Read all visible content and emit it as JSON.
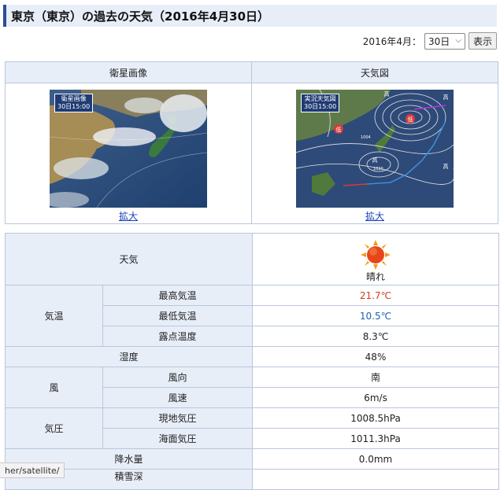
{
  "page": {
    "title": "東京（東京）の過去の天気（2016年4月30日）"
  },
  "date_select": {
    "month_label": "2016年4月：",
    "day_value": "30日",
    "show_button": "表示"
  },
  "maps": {
    "satellite_header": "衛星画像",
    "weather_map_header": "天気図",
    "satellite_badge_line1": "衛星画像",
    "satellite_badge_line2": "30日15:00",
    "weather_map_badge_line1": "実況天気図",
    "weather_map_badge_line2": "30日15:00",
    "satellite_link": "拡大",
    "weather_map_link": "拡大",
    "pressure_low": "低",
    "pressure_high": "高",
    "isobar_1004": "1004",
    "isobar_1020": "1020"
  },
  "weather": {
    "weather_label": "天気",
    "weather_value": "晴れ",
    "temp_group": "気温",
    "max_temp_label": "最高気温",
    "max_temp_value": "21.7℃",
    "min_temp_label": "最低気温",
    "min_temp_value": "10.5℃",
    "dew_label": "露点温度",
    "dew_value": "8.3℃",
    "humidity_label": "湿度",
    "humidity_value": "48%",
    "wind_group": "風",
    "wind_dir_label": "風向",
    "wind_dir_value": "南",
    "wind_speed_label": "風速",
    "wind_speed_value": "6m/s",
    "pressure_group": "気圧",
    "station_pressure_label": "現地気圧",
    "station_pressure_value": "1008.5hPa",
    "sea_pressure_label": "海面気圧",
    "sea_pressure_value": "1011.3hPa",
    "precip_label": "降水量",
    "precip_value": "0.0mm",
    "snow_label": "積雪深"
  },
  "status_bar": {
    "url": "her/satellite/"
  },
  "colors": {
    "header_bg": "#e8eef8",
    "border": "#b9c6dc",
    "max_temp": "#d23c1a",
    "min_temp": "#1c5fb5",
    "link": "#1a3fbf"
  },
  "icons": {
    "weather_icon": "sun-icon"
  }
}
